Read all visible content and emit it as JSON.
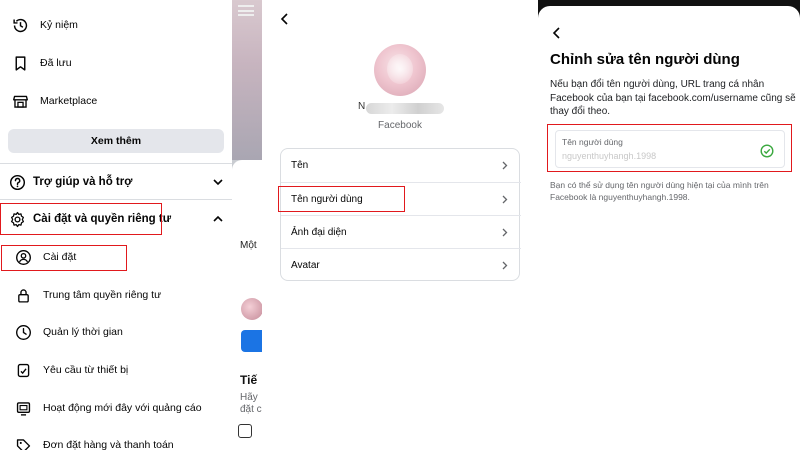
{
  "panel1": {
    "items": [
      {
        "label": "Kỷ niệm",
        "icon": "clock-history-icon"
      },
      {
        "label": "Đã lưu",
        "icon": "bookmark-icon"
      },
      {
        "label": "Marketplace",
        "icon": "storefront-icon"
      }
    ],
    "see_more": "Xem thêm",
    "help_section": "Trợ giúp và hỗ trợ",
    "settings_section": "Cài đặt và quyền riêng tư",
    "settings_items": [
      {
        "label": "Cài đặt",
        "icon": "user-gear-icon"
      },
      {
        "label": "Trung tâm quyền riêng tư",
        "icon": "lock-icon"
      },
      {
        "label": "Quản lý thời gian",
        "icon": "clock-icon"
      },
      {
        "label": "Yêu cầu từ thiết bị",
        "icon": "device-request-icon"
      },
      {
        "label": "Hoạt động mới đây với quảng cáo",
        "icon": "ad-activity-icon"
      },
      {
        "label": "Đơn đặt hàng và thanh toán",
        "icon": "tag-icon"
      }
    ],
    "peek": {
      "text1": "Một",
      "bold": "Tiế",
      "small1": "Hãy",
      "small2": "đặt c"
    }
  },
  "panel2": {
    "name_initial": "N",
    "platform": "Facebook",
    "rows": [
      "Tên",
      "Tên người dùng",
      "Ảnh đại diện",
      "Avatar"
    ]
  },
  "panel3": {
    "title": "Chỉnh sửa tên người dùng",
    "description": "Nếu bạn đổi tên người dùng, URL trang cá nhân Facebook của bạn tại facebook.com/username cũng sẽ thay đổi theo.",
    "field_label": "Tên người dùng",
    "field_value": "nguyenthuyhangh.1998",
    "help": "Bạn có thể sử dụng tên người dùng hiện tại của mình trên Facebook là nguyenthuyhangh.1998."
  },
  "colors": {
    "highlight": "#e1191d",
    "brand_blue": "#1b74e4",
    "check_green": "#3aa83f"
  }
}
